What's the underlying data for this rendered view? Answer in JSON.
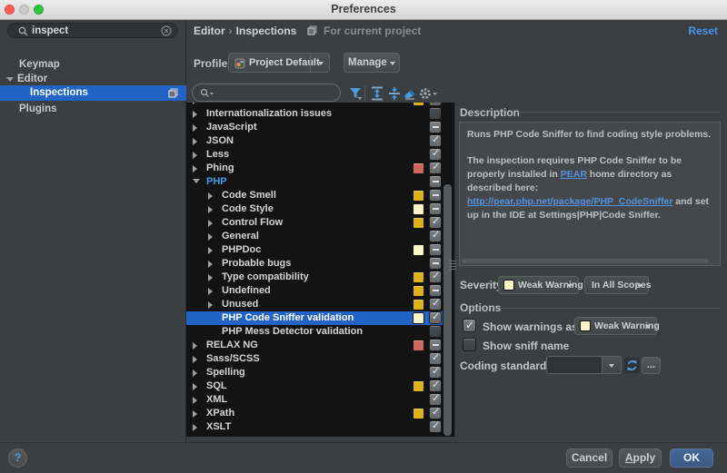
{
  "window": {
    "title": "Preferences"
  },
  "sidebar": {
    "search": {
      "value": "inspect",
      "clear_icon": "clear-circle-icon"
    },
    "items": [
      {
        "label": "Keymap",
        "indent": 1
      },
      {
        "label": "Editor",
        "indent": 0,
        "expanded": true
      },
      {
        "label": "Inspections",
        "indent": 2,
        "selected": true,
        "badge": true
      },
      {
        "label": "Plugins",
        "indent": 1
      }
    ]
  },
  "header": {
    "path": [
      "Editor",
      "Inspections"
    ],
    "separator": "›",
    "context": "For current project",
    "reset_label": "Reset"
  },
  "profile": {
    "label": "Profile:",
    "value": "Project Default",
    "manage_label": "Manage"
  },
  "inspections_toolbar": {
    "icons": [
      "search-icon",
      "filter-icon",
      "expand-all-icon",
      "collapse-all-icon",
      "clear-filter-icon",
      "settings-gear-icon"
    ]
  },
  "tree": {
    "items": [
      {
        "label": "Ini Files",
        "level": 0,
        "arrow": "right",
        "swatch": "#ddb11c",
        "check": "dash"
      },
      {
        "label": "Internationalization issues",
        "level": 0,
        "arrow": "right",
        "swatch": null,
        "check": "empty"
      },
      {
        "label": "JavaScript",
        "level": 0,
        "arrow": "right",
        "swatch": null,
        "check": "dash"
      },
      {
        "label": "JSON",
        "level": 0,
        "arrow": "right",
        "swatch": null,
        "check": "check"
      },
      {
        "label": "Less",
        "level": 0,
        "arrow": "right",
        "swatch": null,
        "check": "check"
      },
      {
        "label": "Phing",
        "level": 0,
        "arrow": "right",
        "swatch": "#cf6660",
        "check": "check"
      },
      {
        "label": "PHP",
        "level": 0,
        "arrow": "down",
        "swatch": null,
        "check": "dash",
        "label_color": "#459be6"
      },
      {
        "label": "Code Smell",
        "level": 1,
        "arrow": "right",
        "swatch": "#ddb11c",
        "check": "dash"
      },
      {
        "label": "Code Style",
        "level": 1,
        "arrow": "right",
        "swatch": "#f8f3c8",
        "check": "dash"
      },
      {
        "label": "Control Flow",
        "level": 1,
        "arrow": "right",
        "swatch": "#ddb11c",
        "check": "check"
      },
      {
        "label": "General",
        "level": 1,
        "arrow": "right",
        "swatch": null,
        "check": "check"
      },
      {
        "label": "PHPDoc",
        "level": 1,
        "arrow": "right",
        "swatch": "#f8f3c8",
        "check": "dash"
      },
      {
        "label": "Probable bugs",
        "level": 1,
        "arrow": "right",
        "swatch": null,
        "check": "dash"
      },
      {
        "label": "Type compatibility",
        "level": 1,
        "arrow": "right",
        "swatch": "#ddb11c",
        "check": "check"
      },
      {
        "label": "Undefined",
        "level": 1,
        "arrow": "right",
        "swatch": "#ddb11c",
        "check": "dash"
      },
      {
        "label": "Unused",
        "level": 1,
        "arrow": "right",
        "swatch": "#ddb11c",
        "check": "check"
      },
      {
        "label": "PHP Code Sniffer validation",
        "level": 1,
        "arrow": null,
        "swatch": "#f8f3c8",
        "check": "check",
        "selected": true
      },
      {
        "label": "PHP Mess Detector validation",
        "level": 1,
        "arrow": null,
        "swatch": null,
        "check": "empty"
      },
      {
        "label": "RELAX NG",
        "level": 0,
        "arrow": "right",
        "swatch": "#cf6660",
        "check": "dash"
      },
      {
        "label": "Sass/SCSS",
        "level": 0,
        "arrow": "right",
        "swatch": null,
        "check": "check"
      },
      {
        "label": "Spelling",
        "level": 0,
        "arrow": "right",
        "swatch": null,
        "check": "check"
      },
      {
        "label": "SQL",
        "level": 0,
        "arrow": "right",
        "swatch": "#ddb11c",
        "check": "check"
      },
      {
        "label": "XML",
        "level": 0,
        "arrow": "right",
        "swatch": null,
        "check": "check"
      },
      {
        "label": "XPath",
        "level": 0,
        "arrow": "right",
        "swatch": "#ddb11c",
        "check": "check"
      },
      {
        "label": "XSLT",
        "level": 0,
        "arrow": "right",
        "swatch": null,
        "check": "check"
      }
    ]
  },
  "description": {
    "title": "Description",
    "paragraphs": [
      [
        {
          "text": "Runs PHP Code Sniffer to find coding style problems."
        }
      ],
      [
        {
          "text": "The inspection requires PHP Code Sniffer to be properly installed in "
        },
        {
          "text": "PEAR",
          "link": true,
          "name": "pear-link"
        },
        {
          "text": " home directory as described here: "
        },
        {
          "text": "http://pear.php.net/package/PHP_CodeSniffer",
          "link": true,
          "name": "codesniffer-link"
        },
        {
          "text": " and set up in the IDE at Settings|PHP|Code Sniffer."
        }
      ]
    ]
  },
  "severity": {
    "label": "Severity:",
    "value": "Weak Warning",
    "color": "#f8f3c8",
    "scope": "In All Scopes"
  },
  "options": {
    "title": "Options",
    "show_warnings": {
      "checked": true,
      "label": "Show warnings as:",
      "value": "Weak Warning",
      "color": "#f8f3c8"
    },
    "show_sniff": {
      "checked": false,
      "label": "Show sniff name"
    },
    "coding_standard": {
      "label": "Coding standard:",
      "value": "",
      "more_label": "...",
      "refresh_icon": "refresh-icon"
    }
  },
  "footer": {
    "help_label": "?",
    "cancel_label": "Cancel",
    "apply_label": "Apply",
    "ok_label": "OK"
  },
  "colors": {
    "selection_blue": "#2264c6",
    "link_blue": "#5592e0",
    "reset_blue": "#4794e8",
    "php_label_blue": "#459be6",
    "severity_yellow": "#ddb11c",
    "severity_cream": "#f8f3c8",
    "severity_red": "#cf6660",
    "tree_background": "#131313",
    "panel_background": "#3c3f41"
  }
}
